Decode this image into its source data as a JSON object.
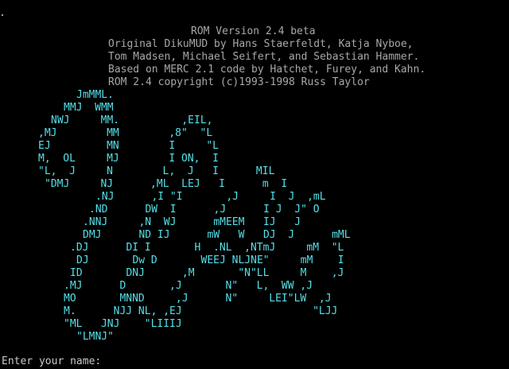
{
  "colors": {
    "background": "#000000",
    "header_text": "#a8a8a8",
    "art_text": "#55e0e8",
    "prompt_text": "#c8c8c8"
  },
  "header": {
    "lines": [
      "ROM Version 2.4 beta",
      "Original DikuMUD by Hans Staerfeldt, Katja Nyboe,",
      "Tom Madsen, Michael Seifert, and Sebastian Hammer.",
      "Based on MERC 2.1 code by Hatchet, Furey, and Kahn.",
      "ROM 2.4 copyright (c)1993-1998 Russ Taylor"
    ]
  },
  "ascii_art": {
    "lines": [
      "JmMML.",
      "MMJ  WMM",
      "NWJ     MM.          ,EIL,",
      ",MJ        MM        ,8\"  \"L",
      "EJ         MN        I     \"L",
      "M,  OL     MJ        I ON,  I",
      "\"L,  J     N        L,  J   I      MIL",
      "\"DMJ     NJ      ,ML  LEJ   I      m  I",
      ".NJ      ,I \"I       ,J     I  J  ,mL",
      ".ND      DW  I      ,J      I J  J\" O",
      ".NNJ     ,N  WJ      mMEEM   IJ   J",
      "DMJ      ND IJ      mW   W   DJ  J      mML",
      ".DJ      DI I       H  .NL  ,NTmJ     mM  \"L",
      "DJ       Dw D       WEEJ NLJNE\"     mM    I",
      "ID       DNJ      ,M       \"N\"LL     M    ,J",
      ".MJ      D       ,J       N\"   L,  WW ,J",
      "MO       MNND     ,J      N\"     LEI\"LW  ,J",
      "M.      NJJ NL, ,EJ                     \"LJJ",
      "\"ML   JNJ    \"LIIIJ",
      "\"LMNJ\""
    ]
  },
  "prompt": {
    "label": "Enter your name:",
    "value": ""
  }
}
